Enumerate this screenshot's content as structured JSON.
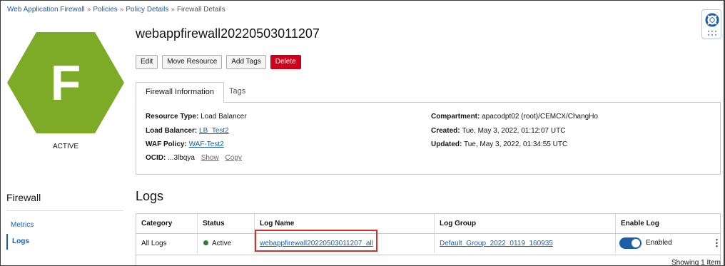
{
  "breadcrumb": {
    "items": [
      "Web Application Firewall",
      "Policies",
      "Policy Details"
    ],
    "separator": "»",
    "current": "Firewall Details"
  },
  "resource": {
    "icon_letter": "F",
    "icon_color": "#7dab27",
    "state": "ACTIVE",
    "title": "webappfirewall20220503011207"
  },
  "actions": {
    "edit": "Edit",
    "move": "Move Resource",
    "tags": "Add Tags",
    "delete": "Delete"
  },
  "tabs": {
    "info": "Firewall Information",
    "tags": "Tags"
  },
  "info": {
    "resource_type_label": "Resource Type:",
    "resource_type_value": "Load Balancer",
    "load_balancer_label": "Load Balancer:",
    "load_balancer_value": "LB_Test2",
    "waf_policy_label": "WAF Policy:",
    "waf_policy_value": "WAF-Test2",
    "ocid_label": "OCID:",
    "ocid_value": "...3lbqya",
    "show": "Show",
    "copy": "Copy",
    "compartment_label": "Compartment:",
    "compartment_value": "apacodpt02 (root)/CEMCX/ChangHo",
    "created_label": "Created:",
    "created_value": "Tue, May 3, 2022, 01:12:07 UTC",
    "updated_label": "Updated:",
    "updated_value": "Tue, May 3, 2022, 01:34:55 UTC"
  },
  "sidebar": {
    "title": "Firewall",
    "items": [
      {
        "label": "Metrics"
      },
      {
        "label": "Logs"
      }
    ]
  },
  "logs": {
    "title": "Logs",
    "columns": [
      "Category",
      "Status",
      "Log Name",
      "Log Group",
      "Enable Log"
    ],
    "rows": [
      {
        "category": "All Logs",
        "status": "Active",
        "log_name": "webappfirewall20220503011207_all",
        "log_group": "Default_Group_2022_0119_160935",
        "enable_log": "Enabled"
      }
    ],
    "footer": "Showing 1 Item"
  },
  "colors": {
    "link": "#1a5eaa",
    "delete": "#d0021b",
    "active_status": "#2e7d32",
    "highlight": "#d32f2f"
  }
}
